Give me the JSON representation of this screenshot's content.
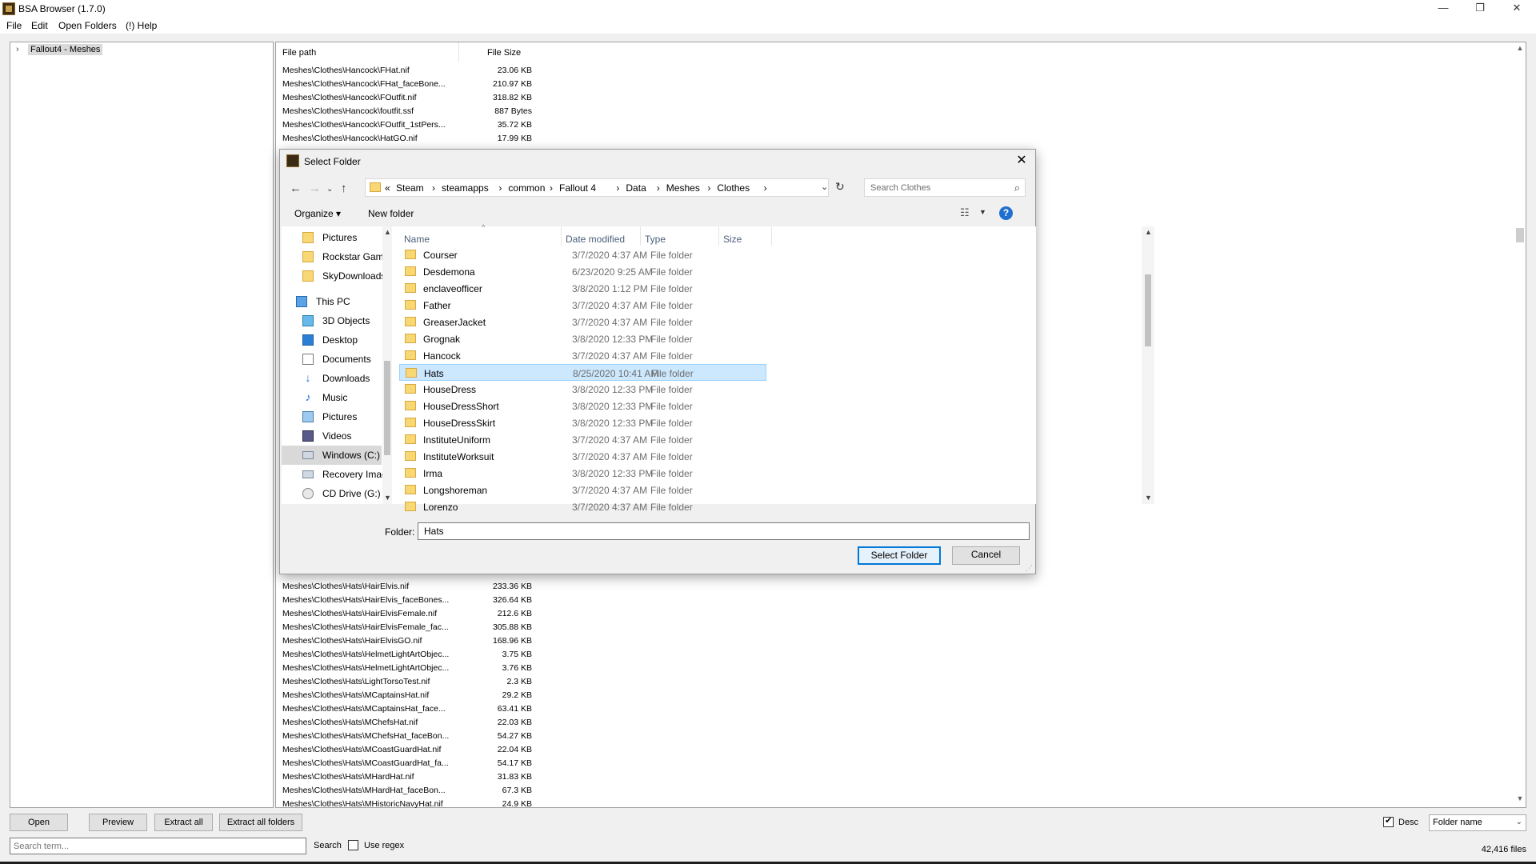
{
  "app": {
    "title": "BSA Browser (1.7.0)",
    "window_controls": [
      "—",
      "❐",
      "✕"
    ]
  },
  "menu": [
    "File",
    "Edit",
    "Open Folders",
    "(!) Help"
  ],
  "tree": {
    "root_label": "Fallout4 - Meshes",
    "chevron": "›"
  },
  "file_list": {
    "headers": {
      "path": "File path",
      "size": "File Size"
    },
    "rows_top": [
      {
        "path": "Meshes\\Clothes\\Hancock\\FHat.nif",
        "size": "23.06 KB"
      },
      {
        "path": "Meshes\\Clothes\\Hancock\\FHat_faceBone...",
        "size": "210.97 KB"
      },
      {
        "path": "Meshes\\Clothes\\Hancock\\FOutfit.nif",
        "size": "318.82 KB"
      },
      {
        "path": "Meshes\\Clothes\\Hancock\\foutfit.ssf",
        "size": "887 Bytes"
      },
      {
        "path": "Meshes\\Clothes\\Hancock\\FOutfit_1stPers...",
        "size": "35.72 KB"
      },
      {
        "path": "Meshes\\Clothes\\Hancock\\HatGO.nif",
        "size": "17.99 KB"
      }
    ],
    "rows_bottom": [
      {
        "path": "Meshes\\Clothes\\Hats\\HairElvis.nif",
        "size": "233.36 KB"
      },
      {
        "path": "Meshes\\Clothes\\Hats\\HairElvis_faceBones...",
        "size": "326.64 KB"
      },
      {
        "path": "Meshes\\Clothes\\Hats\\HairElvisFemale.nif",
        "size": "212.6 KB"
      },
      {
        "path": "Meshes\\Clothes\\Hats\\HairElvisFemale_fac...",
        "size": "305.88 KB"
      },
      {
        "path": "Meshes\\Clothes\\Hats\\HairElvisGO.nif",
        "size": "168.96 KB"
      },
      {
        "path": "Meshes\\Clothes\\Hats\\HelmetLightArtObjec...",
        "size": "3.75 KB"
      },
      {
        "path": "Meshes\\Clothes\\Hats\\HelmetLightArtObjec...",
        "size": "3.76 KB"
      },
      {
        "path": "Meshes\\Clothes\\Hats\\LightTorsoTest.nif",
        "size": "2.3 KB"
      },
      {
        "path": "Meshes\\Clothes\\Hats\\MCaptainsHat.nif",
        "size": "29.2 KB"
      },
      {
        "path": "Meshes\\Clothes\\Hats\\MCaptainsHat_face...",
        "size": "63.41 KB"
      },
      {
        "path": "Meshes\\Clothes\\Hats\\MChefsHat.nif",
        "size": "22.03 KB"
      },
      {
        "path": "Meshes\\Clothes\\Hats\\MChefsHat_faceBon...",
        "size": "54.27 KB"
      },
      {
        "path": "Meshes\\Clothes\\Hats\\MCoastGuardHat.nif",
        "size": "22.04 KB"
      },
      {
        "path": "Meshes\\Clothes\\Hats\\MCoastGuardHat_fa...",
        "size": "54.17 KB"
      },
      {
        "path": "Meshes\\Clothes\\Hats\\MHardHat.nif",
        "size": "31.83 KB"
      },
      {
        "path": "Meshes\\Clothes\\Hats\\MHardHat_faceBon...",
        "size": "67.3 KB"
      },
      {
        "path": "Meshes\\Clothes\\Hats\\MHistoricNavyHat.nif",
        "size": "24.9 KB"
      }
    ]
  },
  "bottom": {
    "buttons": [
      "Open",
      "Preview",
      "Extract all",
      "Extract all folders"
    ],
    "search_placeholder": "Search term...",
    "search_label": "Search",
    "regex_label": "Use regex",
    "desc_label": "Desc",
    "sort_value": "Folder name",
    "file_count": "42,416 files"
  },
  "dialog": {
    "title": "Select Folder",
    "breadcrumbs": [
      "«",
      "Steam",
      "›",
      "steamapps",
      "›",
      "common",
      "›",
      "Fallout 4",
      "›",
      "Data",
      "›",
      "Meshes",
      "›",
      "Clothes",
      "›"
    ],
    "search_placeholder": "Search Clothes",
    "organize_label": "Organize ▾",
    "new_folder_label": "New folder",
    "nav_items": [
      {
        "label": "Pictures",
        "icon": "folder-icon"
      },
      {
        "label": "Rockstar Games",
        "icon": "folder-icon"
      },
      {
        "label": "SkyDownloads",
        "icon": "folder-icon"
      },
      {
        "label": "This PC",
        "icon": "pc-icon"
      },
      {
        "label": "3D Objects",
        "icon": "3d-objects-icon"
      },
      {
        "label": "Desktop",
        "icon": "desktop-icon"
      },
      {
        "label": "Documents",
        "icon": "documents-icon"
      },
      {
        "label": "Downloads",
        "icon": "download-icon"
      },
      {
        "label": "Music",
        "icon": "music-icon"
      },
      {
        "label": "Pictures",
        "icon": "pictures-icon"
      },
      {
        "label": "Videos",
        "icon": "videos-icon"
      },
      {
        "label": "Windows (C:)",
        "icon": "drive-icon"
      },
      {
        "label": "Recovery Image",
        "icon": "drive-icon"
      },
      {
        "label": "CD Drive (G:)",
        "icon": "cd-drive-icon"
      }
    ],
    "columns": {
      "name": "Name",
      "date": "Date modified",
      "type": "Type",
      "size": "Size"
    },
    "files": [
      {
        "name": "Courser",
        "date": "3/7/2020 4:37 AM",
        "type": "File folder"
      },
      {
        "name": "Desdemona",
        "date": "6/23/2020 9:25 AM",
        "type": "File folder"
      },
      {
        "name": "enclaveofficer",
        "date": "3/8/2020 1:12 PM",
        "type": "File folder"
      },
      {
        "name": "Father",
        "date": "3/7/2020 4:37 AM",
        "type": "File folder"
      },
      {
        "name": "GreaserJacket",
        "date": "3/7/2020 4:37 AM",
        "type": "File folder"
      },
      {
        "name": "Grognak",
        "date": "3/8/2020 12:33 PM",
        "type": "File folder"
      },
      {
        "name": "Hancock",
        "date": "3/7/2020 4:37 AM",
        "type": "File folder"
      },
      {
        "name": "Hats",
        "date": "8/25/2020 10:41 AM",
        "type": "File folder"
      },
      {
        "name": "HouseDress",
        "date": "3/8/2020 12:33 PM",
        "type": "File folder"
      },
      {
        "name": "HouseDressShort",
        "date": "3/8/2020 12:33 PM",
        "type": "File folder"
      },
      {
        "name": "HouseDressSkirt",
        "date": "3/8/2020 12:33 PM",
        "type": "File folder"
      },
      {
        "name": "InstituteUniform",
        "date": "3/7/2020 4:37 AM",
        "type": "File folder"
      },
      {
        "name": "InstituteWorksuit",
        "date": "3/7/2020 4:37 AM",
        "type": "File folder"
      },
      {
        "name": "Irma",
        "date": "3/8/2020 12:33 PM",
        "type": "File folder"
      },
      {
        "name": "Longshoreman",
        "date": "3/7/2020 4:37 AM",
        "type": "File folder"
      },
      {
        "name": "Lorenzo",
        "date": "3/7/2020 4:37 AM",
        "type": "File folder"
      }
    ],
    "selected_file": "Hats",
    "folder_label": "Folder:",
    "folder_value": "Hats",
    "select_button": "Select Folder",
    "cancel_button": "Cancel"
  },
  "colors": {
    "selection": "#cce8ff",
    "accent": "#0078d7",
    "folder": "#f8d775"
  }
}
